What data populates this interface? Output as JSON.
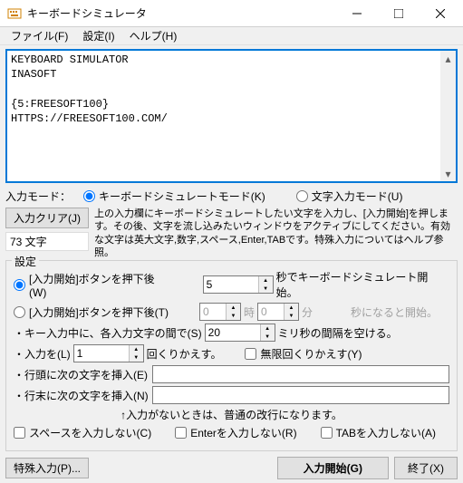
{
  "window": {
    "title": "キーボードシミュレータ"
  },
  "menu": {
    "file": "ファイル(F)",
    "settings": "設定(I)",
    "help": "ヘルプ(H)"
  },
  "editor": {
    "content": "KEYBOARD SIMULATOR\nINASOFT\n\n{5:FREESOFT100}\nHTTPS://FREESOFT100.COM/"
  },
  "mode": {
    "label": "入力モード：",
    "keyboard": "キーボードシミュレートモード(K)",
    "text": "文字入力モード(U)"
  },
  "clear_btn": "入力クリア(J)",
  "instruction": "上の入力欄にキーボードシミュレートしたい文字を入力し、[入力開始]を押します。その後、文字を流し込みたいウィンドウをアクティブにしてください。有効な文字は英大文字,数字,スペース,Enter,TABです。特殊入力についてはヘルプ参照。",
  "char_count": "73 文字",
  "settings": {
    "title": "設定",
    "start_after_sec_label": "[入力開始]ボタンを押下後(W)",
    "start_after_sec_value": "5",
    "start_after_sec_suffix": "秒でキーボードシミュレート開始。",
    "start_after_time_label": "[入力開始]ボタンを押下後(T)",
    "hour_value": "0",
    "hour_unit": "時",
    "min_value": "0",
    "min_unit": "分",
    "time_suffix": "秒になると開始。",
    "key_interval_label": "・キー入力中に、各入力文字の間で(S)",
    "key_interval_value": "20",
    "key_interval_suffix": "ミリ秒の間隔を空ける。",
    "repeat_label": "・入力を(L)",
    "repeat_value": "1",
    "repeat_suffix": "回くりかえす。",
    "infinite_repeat": "無限回くりかえす(Y)",
    "line_head_label": "・行頭に次の文字を挿入(E)",
    "line_head_value": "",
    "line_end_label": "・行末に次の文字を挿入(N)",
    "line_end_value": "",
    "hint": "↑入力がないときは、普通の改行になります。",
    "no_space": "スペースを入力しない(C)",
    "no_enter": "Enterを入力しない(R)",
    "no_tab": "TABを入力しない(A)"
  },
  "buttons": {
    "special": "特殊入力(P)...",
    "start": "入力開始(G)",
    "exit": "終了(X)"
  }
}
